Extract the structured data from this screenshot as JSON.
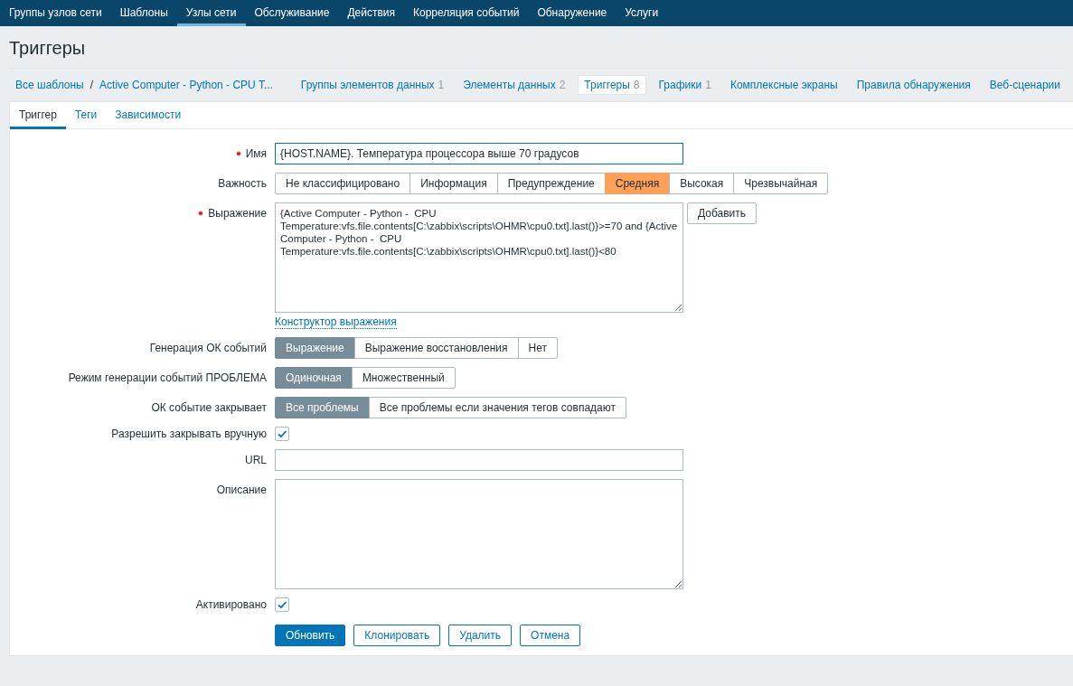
{
  "nav": {
    "items": [
      {
        "label": "Группы узлов сети",
        "selected": false
      },
      {
        "label": "Шаблоны",
        "selected": false
      },
      {
        "label": "Узлы сети",
        "selected": true
      },
      {
        "label": "Обслуживание",
        "selected": false
      },
      {
        "label": "Действия",
        "selected": false
      },
      {
        "label": "Корреляция событий",
        "selected": false
      },
      {
        "label": "Обнаружение",
        "selected": false
      },
      {
        "label": "Услуги",
        "selected": false
      }
    ]
  },
  "page_title": "Триггеры",
  "breadcrumbs": {
    "items": [
      "Все шаблоны",
      "Active Computer - Python - CPU T..."
    ],
    "separator": "/"
  },
  "host_tabs": [
    {
      "label": "Группы элементов данных",
      "count": "1",
      "selected": false
    },
    {
      "label": "Элементы данных",
      "count": "2",
      "selected": false
    },
    {
      "label": "Триггеры",
      "count": "8",
      "selected": true
    },
    {
      "label": "Графики",
      "count": "1",
      "selected": false
    },
    {
      "label": "Комплексные экраны",
      "selected": false
    },
    {
      "label": "Правила обнаружения",
      "selected": false
    },
    {
      "label": "Веб-сценарии",
      "selected": false
    }
  ],
  "form_tabs": [
    {
      "label": "Триггер",
      "selected": true
    },
    {
      "label": "Теги",
      "selected": false
    },
    {
      "label": "Зависимости",
      "selected": false
    }
  ],
  "form": {
    "name": {
      "label": "Имя",
      "required": true,
      "value": "{HOST.NAME}. Температура процессора выше 70 градусов"
    },
    "severity": {
      "label": "Важность",
      "options": [
        {
          "label": "Не классифицировано",
          "selected": false
        },
        {
          "label": "Информация",
          "selected": false
        },
        {
          "label": "Предупреждение",
          "selected": false
        },
        {
          "label": "Средняя",
          "selected": true,
          "color": "#ffa059"
        },
        {
          "label": "Высокая",
          "selected": false
        },
        {
          "label": "Чрезвычайная",
          "selected": false
        }
      ]
    },
    "expression": {
      "label": "Выражение",
      "required": true,
      "value": "{Active Computer - Python -  CPU Temperature:vfs.file.contents[C:\\zabbix\\scripts\\OHMR\\cpu0.txt].last()}>=70 and {Active Computer - Python -  CPU Temperature:vfs.file.contents[C:\\zabbix\\scripts\\OHMR\\cpu0.txt].last()}<80",
      "button": "Добавить",
      "link": "Конструктор выражения"
    },
    "ok_event_generation": {
      "label": "Генерация ОК событий",
      "options": [
        {
          "label": "Выражение",
          "selected": true
        },
        {
          "label": "Выражение восстановления",
          "selected": false
        },
        {
          "label": "Нет",
          "selected": false
        }
      ]
    },
    "problem_mode": {
      "label": "Режим генерации событий ПРОБЛЕМА",
      "options": [
        {
          "label": "Одиночная",
          "selected": true
        },
        {
          "label": "Множественный",
          "selected": false
        }
      ]
    },
    "ok_closes": {
      "label": "ОК событие закрывает",
      "options": [
        {
          "label": "Все проблемы",
          "selected": true
        },
        {
          "label": "Все проблемы если значения тегов совпадают",
          "selected": false
        }
      ]
    },
    "manual_close": {
      "label": "Разрешить закрывать вручную",
      "checked": true
    },
    "url": {
      "label": "URL"
    },
    "description": {
      "label": "Описание"
    },
    "enabled": {
      "label": "Активировано",
      "checked": true
    },
    "buttons": [
      {
        "label": "Обновить",
        "kind": "primary"
      },
      {
        "label": "Клонировать",
        "kind": "secondary"
      },
      {
        "label": "Удалить",
        "kind": "secondary"
      },
      {
        "label": "Отмена",
        "kind": "secondary"
      }
    ]
  }
}
